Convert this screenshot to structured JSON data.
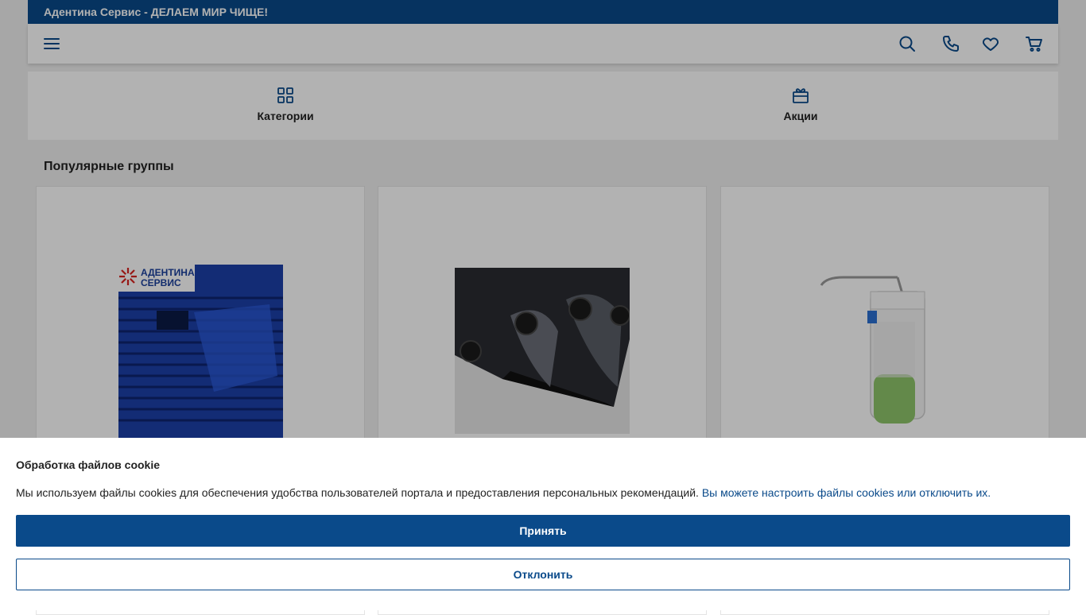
{
  "topbar": {
    "text": "Адентина Сервис - ДЕЛАЕМ МИР ЧИЩЕ!"
  },
  "header": {
    "icons": [
      "menu-icon",
      "search-icon",
      "phone-icon",
      "heart-icon",
      "cart-icon"
    ]
  },
  "quick_nav": [
    {
      "label": "Категории",
      "icon": "grid-icon"
    },
    {
      "label": "Акции",
      "icon": "gift-icon"
    }
  ],
  "popular": {
    "title": "Популярные группы",
    "cards": [
      {
        "image": "blue-mats-image",
        "logo_text": [
          "АДЕНТИНА",
          "СЕРВИС"
        ]
      },
      {
        "image": "dirt-mats-image"
      },
      {
        "image": "elbow-dispenser-image"
      }
    ]
  },
  "cookie": {
    "title": "Обработка файлов cookie",
    "text": "Мы используем файлы cookies для обеспечения удобства пользователей портала и предоставления персональных рекомендаций.",
    "link": "Вы можете настроить файлы cookies или отключить их.",
    "accept": "Принять",
    "decline": "Отклонить"
  },
  "colors": {
    "brand": "#0a4a8a",
    "overlay": "rgba(0,0,0,0.3)"
  }
}
